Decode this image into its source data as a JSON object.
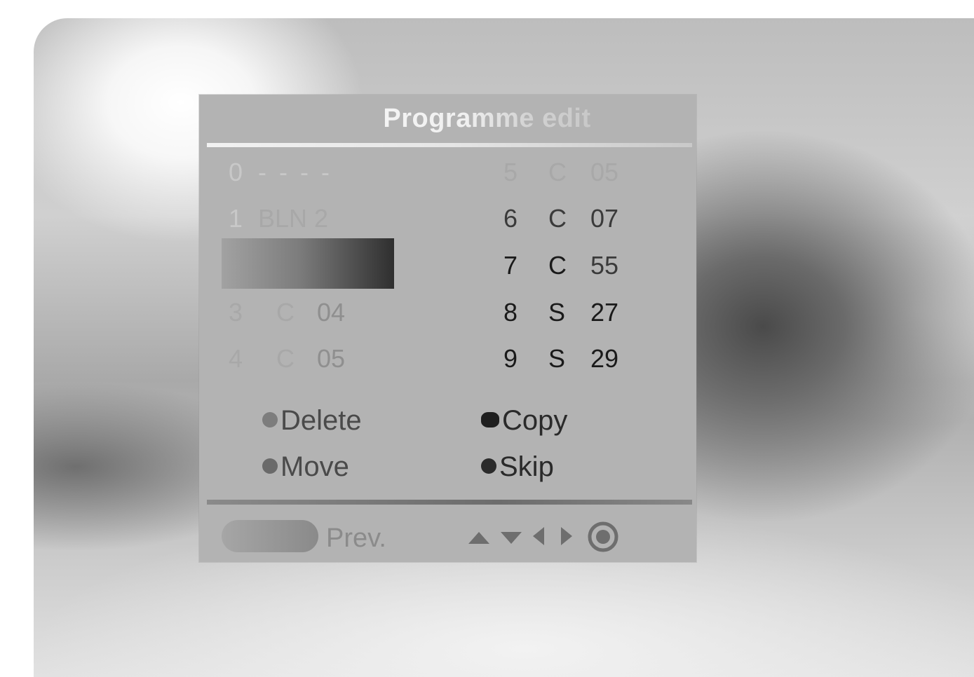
{
  "menu": {
    "title": "Programme edit",
    "left_column": [
      {
        "number": "0",
        "name": "- - - -"
      },
      {
        "number": "1",
        "name": "BLN 2"
      },
      {
        "number": "",
        "name": ""
      },
      {
        "number": "3",
        "type": "C",
        "channel": "04"
      },
      {
        "number": "4",
        "type": "C",
        "channel": "05"
      }
    ],
    "right_column": [
      {
        "number": "5",
        "type": "C",
        "channel": "05"
      },
      {
        "number": "6",
        "type": "C",
        "channel": "07"
      },
      {
        "number": "7",
        "type": "C",
        "channel": "55"
      },
      {
        "number": "8",
        "type": "S",
        "channel": "27"
      },
      {
        "number": "9",
        "type": "S",
        "channel": "29"
      }
    ]
  },
  "functions": {
    "delete_label": "Delete",
    "copy_label": "Copy",
    "move_label": "Move",
    "skip_label": "Skip"
  },
  "footer": {
    "prev_label": "Prev.",
    "nav_icons": [
      "arrow-up-icon",
      "arrow-down-icon",
      "arrow-left-icon",
      "arrow-right-icon",
      "ok-icon"
    ]
  }
}
